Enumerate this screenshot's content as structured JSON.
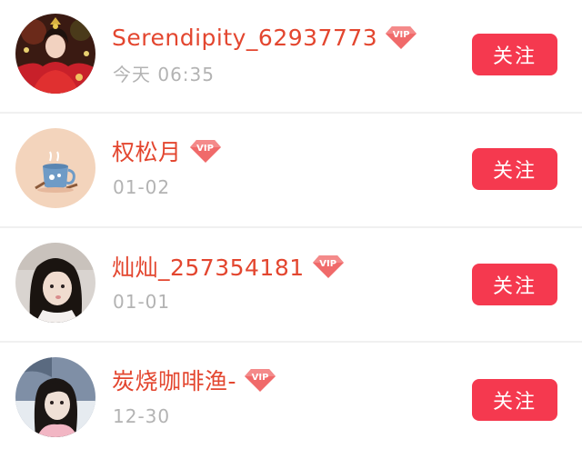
{
  "users": [
    {
      "name": "Serendipity_62937773",
      "badge": "VIP",
      "time": "今天 06:35",
      "follow_label": "关注",
      "avatar": "avatar-costume-girl"
    },
    {
      "name": "权松月",
      "badge": "VIP",
      "time": "01-02",
      "follow_label": "关注",
      "avatar": "avatar-illustration-mug"
    },
    {
      "name": "灿灿_257354181",
      "badge": "VIP",
      "time": "01-01",
      "follow_label": "关注",
      "avatar": "avatar-girl-photo"
    },
    {
      "name": "炭烧咖啡渔-",
      "badge": "VIP",
      "time": "12-30",
      "follow_label": "关注",
      "avatar": "avatar-girl-winter"
    }
  ],
  "colors": {
    "name": "#e3462f",
    "time": "#b3b3b3",
    "follow_button": "#f5394f",
    "vip_badge": "#f06a6a",
    "divider": "#f0f0f0"
  }
}
